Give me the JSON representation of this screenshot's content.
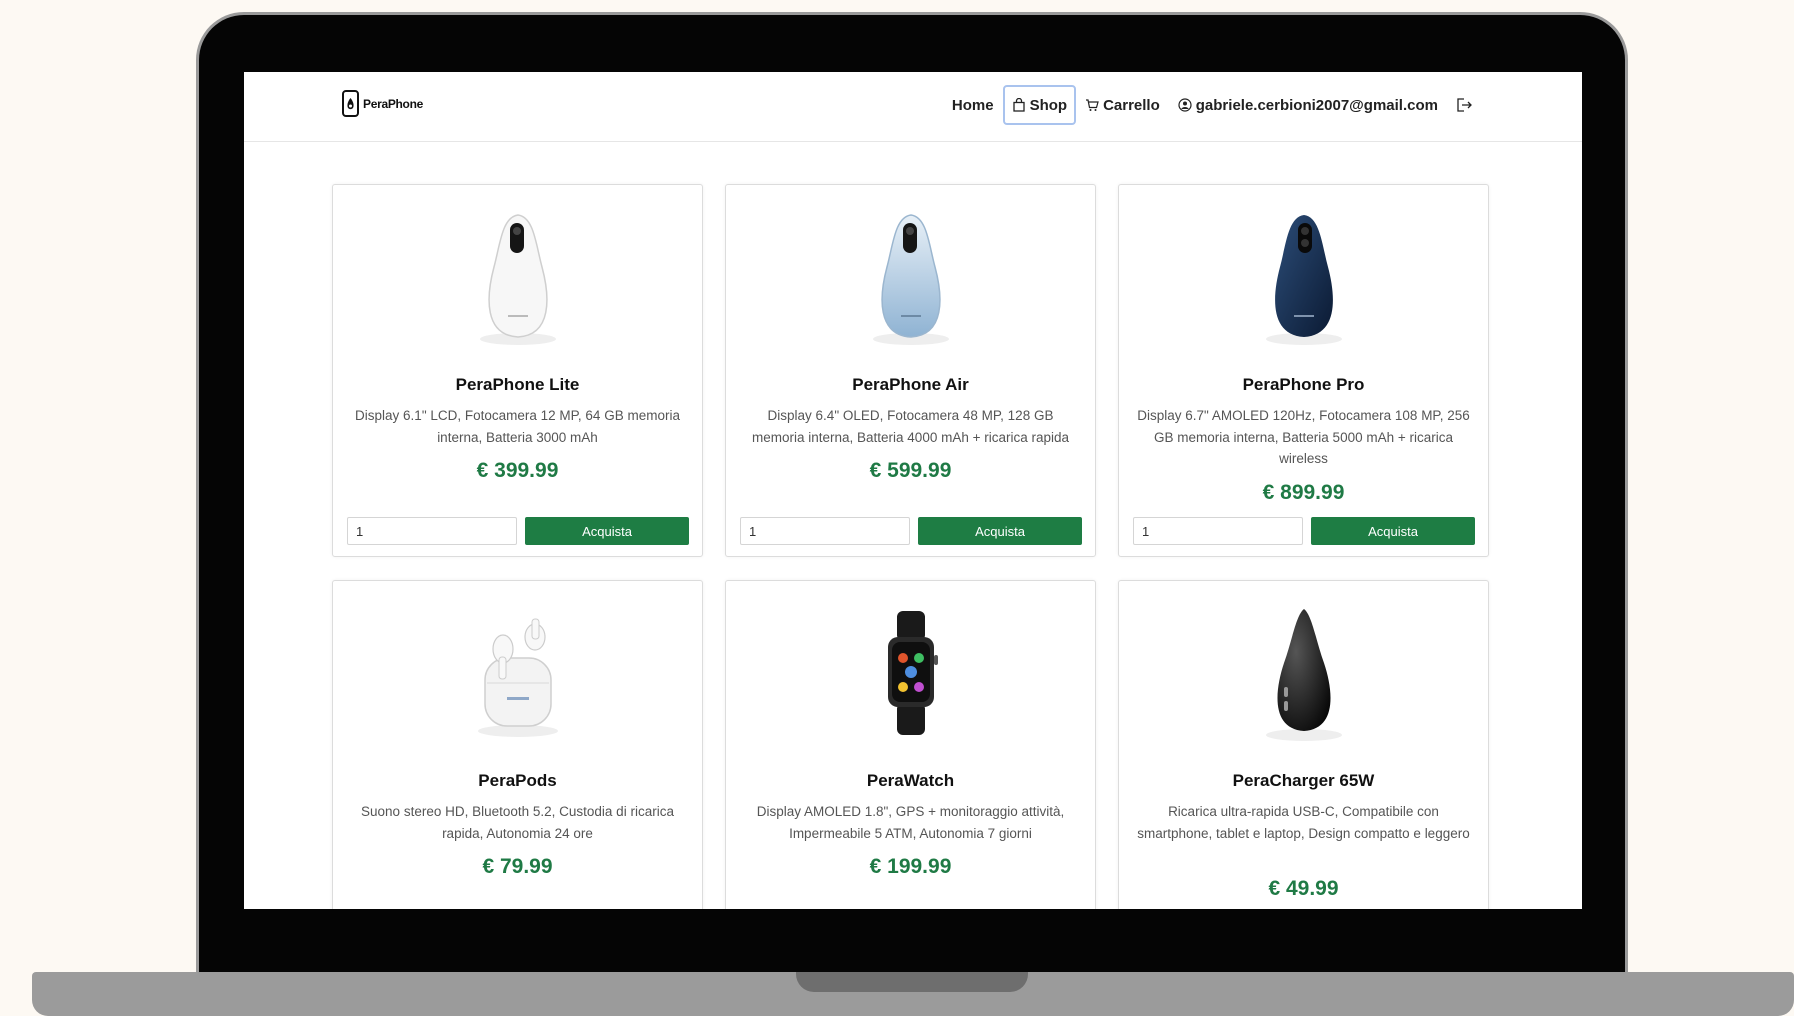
{
  "brand": {
    "name": "PeraPhone"
  },
  "nav": {
    "home": "Home",
    "shop": "Shop",
    "cart": "Carrello",
    "user_email": "gabriele.cerbioni2007@gmail.com"
  },
  "products": [
    {
      "name": "PeraPhone Lite",
      "description": "Display 6.1\" LCD, Fotocamera 12 MP, 64 GB memoria interna, Batteria 3000 mAh",
      "price": "€ 399.99",
      "qty": "1",
      "buy_label": "Acquista",
      "image": "white-pear-phone"
    },
    {
      "name": "PeraPhone Air",
      "description": "Display 6.4\" OLED, Fotocamera 48 MP, 128 GB memoria interna, Batteria 4000 mAh + ricarica rapida",
      "price": "€ 599.99",
      "qty": "1",
      "buy_label": "Acquista",
      "image": "light-blue-pear-phone"
    },
    {
      "name": "PeraPhone Pro",
      "description": "Display 6.7\" AMOLED 120Hz, Fotocamera 108 MP, 256 GB memoria interna, Batteria 5000 mAh + ricarica wireless",
      "price": "€ 899.99",
      "qty": "1",
      "buy_label": "Acquista",
      "image": "navy-pear-phone"
    },
    {
      "name": "PeraPods",
      "description": "Suono stereo HD, Bluetooth 5.2, Custodia di ricarica rapida, Autonomia 24 ore",
      "price": "€ 79.99",
      "image": "earbuds-case"
    },
    {
      "name": "PeraWatch",
      "description": "Display AMOLED 1.8\", GPS + monitoraggio attività, Impermeabile 5 ATM, Autonomia 7 giorni",
      "price": "€ 199.99",
      "image": "smartwatch"
    },
    {
      "name": "PeraCharger 65W",
      "description": "Ricarica ultra-rapida USB-C, Compatibile con smartphone, tablet e laptop, Design compatto e leggero",
      "price": "€ 49.99",
      "image": "black-pear-charger"
    }
  ],
  "colors": {
    "accent": "#1e7d44",
    "price": "#1f7a45",
    "active_outline": "#a9c3ee"
  }
}
